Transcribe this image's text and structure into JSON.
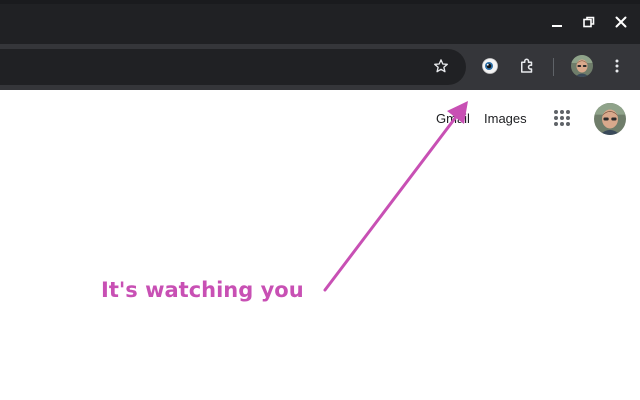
{
  "window_controls": {
    "minimize_icon": "minimize-icon",
    "restore_icon": "restore-icon",
    "close_icon": "close-icon"
  },
  "toolbar": {
    "bookmark_icon": "star-icon",
    "extension_eye_icon": "eye-icon",
    "extensions_icon": "puzzle-icon",
    "menu_icon": "kebab-menu-icon"
  },
  "page": {
    "links": {
      "gmail": "Gmail",
      "images": "Images"
    },
    "apps_icon": "apps-grid-icon"
  },
  "annotation": {
    "text": "It's watching you",
    "color": "#c850b4"
  },
  "colors": {
    "titlebar": "#202124",
    "toolbar": "#35363a",
    "omnibox": "#202124",
    "page_background": "#ffffff"
  }
}
